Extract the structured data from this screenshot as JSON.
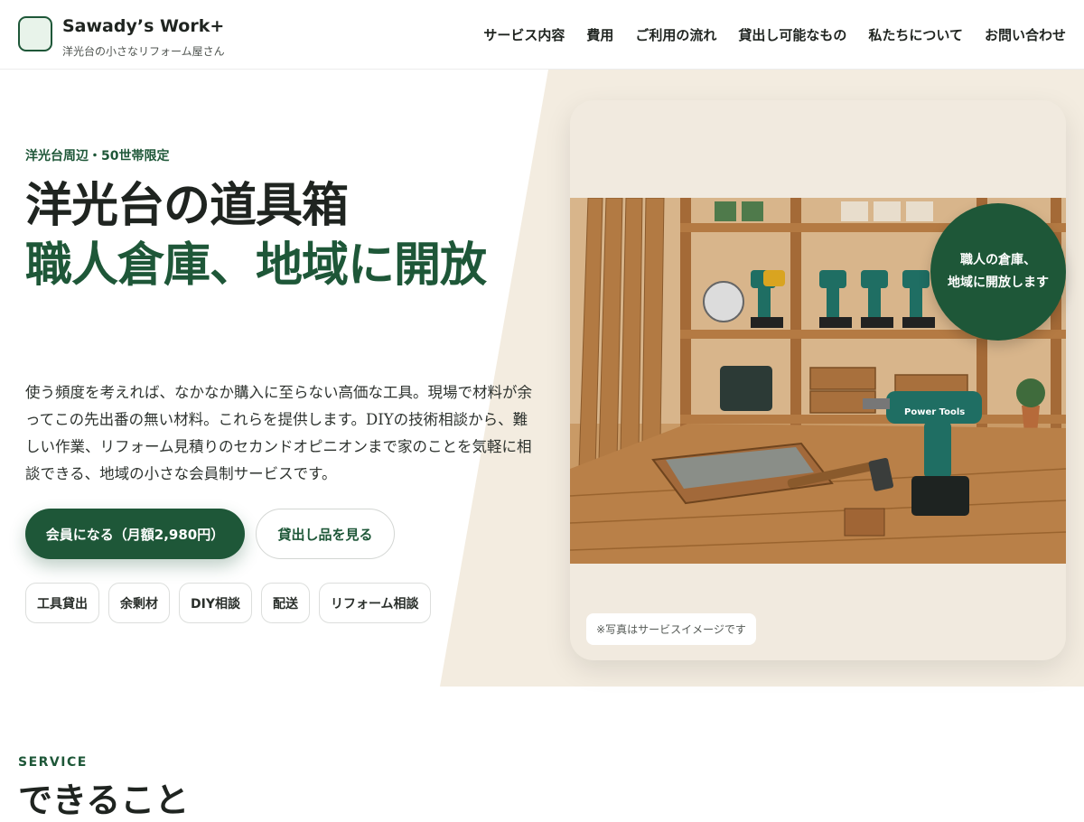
{
  "header": {
    "brand_name": "Sawady’s Work+",
    "brand_tagline": "洋光台の小さなリフォーム屋さん",
    "nav": [
      {
        "label": "サービス内容"
      },
      {
        "label": "費用"
      },
      {
        "label": "ご利用の流れ"
      },
      {
        "label": "貸出し可能なもの"
      },
      {
        "label": "私たちについて"
      },
      {
        "label": "お問い合わせ"
      }
    ]
  },
  "hero": {
    "eyebrow": "洋光台周辺・50世帯限定",
    "headline_line1": "洋光台の道具箱",
    "headline_line2": "職人倉庫、地域に開放",
    "lead": "使う頻度を考えれば、なかなか購入に至らない高価な工具。現場で材料が余ってこの先出番の無い材料。これらを提供します。DIYの技術相談から、難しい作業、リフォーム見積りのセカンドオピニオンまで家のことを気軽に相談できる、地域の小さな会員制サービスです。",
    "primary_button": "会員になる（月額2,980円）",
    "secondary_button": "貸出し品を見る",
    "tags": [
      {
        "label": "工具貸出"
      },
      {
        "label": "余剰材"
      },
      {
        "label": "DIY相談"
      },
      {
        "label": "配送"
      },
      {
        "label": "リフォーム相談"
      }
    ],
    "badge_line1": "職人の倉庫、",
    "badge_line2": "地域に開放します",
    "photo_caption": "※写真はサービスイメージです",
    "photo_brand_text": "Power Tools"
  },
  "service": {
    "eyebrow": "SERVICE",
    "title": "できること"
  },
  "colors": {
    "primary": "#1e5738",
    "hero_panel": "#f3ece0",
    "wood": "#b07a45",
    "tool_teal": "#1f6e63"
  }
}
